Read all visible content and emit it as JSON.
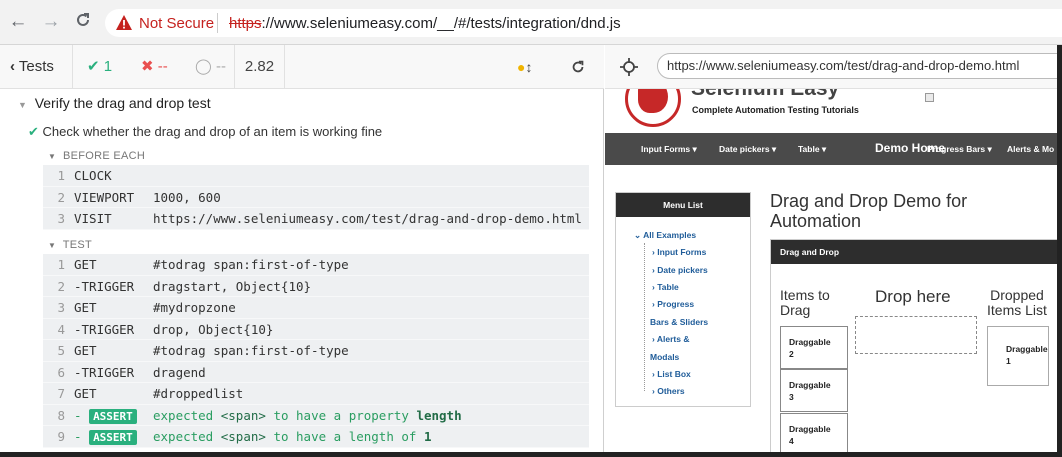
{
  "browser": {
    "back": "←",
    "forward": "→",
    "reload": "C",
    "security_label": "Not Secure",
    "url_scheme": "https",
    "url_rest": "://www.seleniumeasy.com/__/#/tests/integration/dnd.js"
  },
  "reporter": {
    "tests_label": "Tests",
    "passed": "1",
    "failed": "--",
    "pending": "--",
    "duration": "2.82",
    "suite_title": "Verify the drag and drop test",
    "test_title": "Check whether the drag and drop of an item is working fine",
    "before_each_label": "BEFORE EACH",
    "test_label": "TEST",
    "before_each": [
      {
        "num": "1",
        "name": "CLOCK",
        "msg": ""
      },
      {
        "num": "2",
        "name": "VIEWPORT",
        "msg": "1000, 600"
      },
      {
        "num": "3",
        "name": "VISIT",
        "msg": "https://www.seleniumeasy.com/test/drag-and-drop-demo.html"
      }
    ],
    "commands": [
      {
        "num": "1",
        "name": "GET",
        "msg": "#todrag span:first-of-type"
      },
      {
        "num": "2",
        "name": "-TRIGGER",
        "msg": "dragstart, Object{10}"
      },
      {
        "num": "3",
        "name": "GET",
        "msg": "#mydropzone"
      },
      {
        "num": "4",
        "name": "-TRIGGER",
        "msg": "drop, Object{10}"
      },
      {
        "num": "5",
        "name": "GET",
        "msg": "#todrag span:first-of-type"
      },
      {
        "num": "6",
        "name": "-TRIGGER",
        "msg": "dragend"
      },
      {
        "num": "7",
        "name": "GET",
        "msg": "#droppedlist"
      },
      {
        "num": "8",
        "name": "ASSERT",
        "msg_a": "expected",
        "msg_b": "<span>",
        "msg_c": "to have a property",
        "msg_d": "length"
      },
      {
        "num": "9",
        "name": "ASSERT",
        "msg_a": "expected",
        "msg_b": "<span>",
        "msg_c": "to have a length of",
        "msg_d": "1"
      }
    ]
  },
  "aut": {
    "url": "https://www.seleniumeasy.com/test/drag-and-drop-demo.html",
    "brand": "Selenium Easy",
    "tagline": "Complete Automation Testing Tutorials",
    "nav": [
      "Input Forms ▾",
      "Date pickers ▾",
      "Table ▾",
      "Demo Home",
      "Progress Bars ▾",
      "Alerts & Mo"
    ],
    "menu_title": "Menu List",
    "menu": {
      "all": "All Examples",
      "items": [
        "Input Forms",
        "Date pickers",
        "Table",
        "Progress",
        "Bars & Sliders",
        "Alerts &",
        "Modals",
        "List Box",
        "Others"
      ]
    },
    "heading_1": "Drag and Drop Demo for",
    "heading_2": "Automation",
    "panel_title": "Drag and Drop",
    "items_to_drag_1": "Items to",
    "items_to_drag_2": "Drag",
    "drop_here": "Drop here",
    "dropped_1": "Dropped",
    "dropped_2": "Items List",
    "draggables": [
      {
        "label": "Draggable",
        "num": "2"
      },
      {
        "label": "Draggable",
        "num": "3"
      },
      {
        "label": "Draggable",
        "num": "4"
      }
    ],
    "dropped_item": {
      "label": "Draggable",
      "num": "1"
    }
  }
}
